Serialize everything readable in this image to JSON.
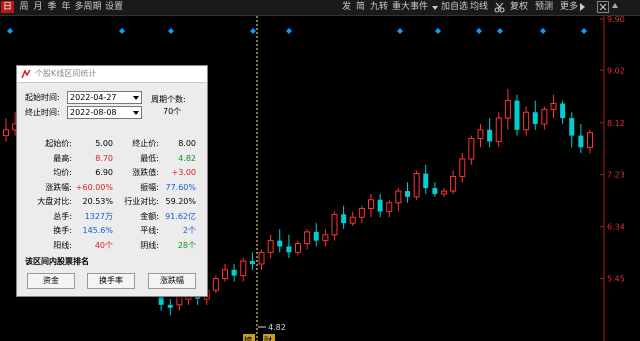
{
  "period_tabs": [
    {
      "label": "日",
      "active": true
    },
    {
      "label": "周",
      "active": false
    },
    {
      "label": "月",
      "active": false
    },
    {
      "label": "季",
      "active": false
    },
    {
      "label": "年",
      "active": false
    },
    {
      "label": "多周期",
      "active": false
    },
    {
      "label": "设置",
      "active": false
    }
  ],
  "toolbar_right": [
    "发",
    "简",
    "九转",
    "重大事件",
    "加自选",
    "均线",
    "复权",
    "预测",
    "更多"
  ],
  "colors": {
    "up": "#ff3333",
    "down": "#00d0d0",
    "axis_label": "#e03030",
    "diamond": "#00a0ff",
    "selection": "#ffff80"
  },
  "axis": {
    "price_labels": [
      "9.90",
      "9.02",
      "8.12",
      "7.23",
      "6.34",
      "5.45"
    ]
  },
  "low_marker": "4.82",
  "bottom_marks": [
    "榜",
    "财"
  ],
  "chart_data": {
    "type": "candlestick",
    "ylim": [
      4.5,
      9.95
    ],
    "y_ticks": [
      9.9,
      9.02,
      8.12,
      7.23,
      6.34,
      5.45
    ],
    "candles": [
      [
        7.9,
        8.2,
        8.0,
        7.8
      ],
      [
        8.0,
        8.3,
        8.1,
        7.9
      ],
      [
        7.9,
        8.0,
        7.5,
        7.4
      ],
      [
        7.5,
        7.7,
        7.6,
        7.3
      ],
      [
        7.6,
        7.9,
        7.7,
        7.5
      ],
      [
        6.8,
        7.0,
        6.9,
        6.6
      ],
      [
        6.9,
        7.0,
        6.8,
        6.7
      ],
      [
        6.9,
        7.1,
        7.0,
        6.8
      ],
      [
        6.9,
        7.0,
        6.85,
        6.7
      ],
      [
        6.8,
        6.9,
        6.7,
        6.6
      ],
      [
        6.7,
        6.8,
        6.5,
        6.4
      ],
      [
        6.5,
        6.6,
        6.2,
        6.1
      ],
      [
        6.2,
        6.3,
        6.0,
        5.9
      ],
      [
        6.0,
        6.1,
        5.7,
        5.6
      ],
      [
        5.7,
        5.9,
        5.8,
        5.6
      ],
      [
        5.8,
        5.9,
        5.6,
        5.5
      ],
      [
        5.6,
        5.7,
        5.3,
        5.2
      ],
      [
        5.3,
        5.4,
        5.0,
        4.9
      ],
      [
        5.0,
        5.1,
        4.95,
        4.82
      ],
      [
        5.0,
        5.2,
        5.15,
        4.9
      ],
      [
        5.1,
        5.3,
        5.25,
        5.0
      ],
      [
        5.2,
        5.4,
        5.1,
        5.0
      ],
      [
        5.1,
        5.3,
        5.25,
        5.0
      ],
      [
        5.25,
        5.5,
        5.45,
        5.2
      ],
      [
        5.45,
        5.7,
        5.6,
        5.4
      ],
      [
        5.6,
        5.7,
        5.5,
        5.4
      ],
      [
        5.5,
        5.8,
        5.75,
        5.4
      ],
      [
        5.75,
        5.9,
        5.7,
        5.6
      ],
      [
        5.7,
        5.95,
        5.9,
        5.6
      ],
      [
        5.9,
        6.2,
        6.1,
        5.8
      ],
      [
        6.1,
        6.3,
        6.0,
        5.9
      ],
      [
        6.0,
        6.2,
        5.9,
        5.8
      ],
      [
        5.9,
        6.1,
        6.05,
        5.85
      ],
      [
        6.05,
        6.3,
        6.25,
        5.95
      ],
      [
        6.25,
        6.4,
        6.1,
        6.0
      ],
      [
        6.1,
        6.3,
        6.2,
        6.0
      ],
      [
        6.2,
        6.6,
        6.55,
        6.1
      ],
      [
        6.55,
        6.7,
        6.4,
        6.3
      ],
      [
        6.4,
        6.6,
        6.5,
        6.35
      ],
      [
        6.5,
        6.7,
        6.65,
        6.4
      ],
      [
        6.65,
        6.9,
        6.8,
        6.5
      ],
      [
        6.8,
        6.9,
        6.6,
        6.5
      ],
      [
        6.6,
        6.8,
        6.75,
        6.5
      ],
      [
        6.75,
        7.0,
        6.95,
        6.6
      ],
      [
        6.95,
        7.1,
        6.85,
        6.75
      ],
      [
        6.85,
        7.3,
        7.25,
        6.8
      ],
      [
        7.25,
        7.4,
        7.0,
        6.9
      ],
      [
        7.0,
        7.1,
        6.9,
        6.85
      ],
      [
        6.9,
        7.0,
        6.95,
        6.85
      ],
      [
        6.95,
        7.3,
        7.2,
        6.9
      ],
      [
        7.2,
        7.6,
        7.5,
        7.1
      ],
      [
        7.5,
        7.9,
        7.85,
        7.4
      ],
      [
        7.85,
        8.1,
        8.0,
        7.7
      ],
      [
        8.0,
        8.2,
        7.8,
        7.7
      ],
      [
        7.8,
        8.3,
        8.2,
        7.7
      ],
      [
        8.2,
        8.7,
        8.5,
        8.0
      ],
      [
        8.5,
        8.6,
        8.0,
        7.9
      ],
      [
        8.0,
        8.4,
        8.3,
        7.9
      ],
      [
        8.3,
        8.5,
        8.1,
        8.0
      ],
      [
        8.1,
        8.4,
        8.35,
        8.0
      ],
      [
        8.35,
        8.6,
        8.45,
        8.2
      ],
      [
        8.45,
        8.5,
        8.2,
        8.1
      ],
      [
        8.2,
        8.3,
        7.9,
        7.7
      ],
      [
        7.9,
        8.1,
        7.7,
        7.6
      ],
      [
        7.7,
        8.0,
        7.95,
        7.6
      ]
    ]
  },
  "dialog": {
    "title": "个股K线区间统计",
    "start_label": "起始时间:",
    "start_value": "2022-04-27",
    "end_label": "终止时间:",
    "end_value": "2022-08-08",
    "period_label": "周期个数:",
    "period_value": "70个",
    "stats": [
      [
        {
          "t": "起始价:",
          "c": "blk"
        },
        {
          "t": "5.00",
          "c": "blk"
        },
        {
          "t": "终止价:",
          "c": "blk"
        },
        {
          "t": "8.00",
          "c": "blk"
        }
      ],
      [
        {
          "t": "最高:",
          "c": "blk"
        },
        {
          "t": "8.70",
          "c": "red"
        },
        {
          "t": "最低:",
          "c": "blk"
        },
        {
          "t": "4.82",
          "c": "green"
        }
      ],
      [
        {
          "t": "均价:",
          "c": "blk"
        },
        {
          "t": "6.90",
          "c": "blk"
        },
        {
          "t": "涨跌值:",
          "c": "blk"
        },
        {
          "t": "+3.00",
          "c": "red"
        }
      ],
      [
        {
          "t": "涨跌幅:",
          "c": "blk"
        },
        {
          "t": "+60.00%",
          "c": "red"
        },
        {
          "t": "振幅:",
          "c": "blk"
        },
        {
          "t": "77.60%",
          "c": "blue"
        }
      ],
      [
        {
          "t": "大盘对比:",
          "c": "blk"
        },
        {
          "t": "20.53%",
          "c": "blk"
        },
        {
          "t": "行业对比:",
          "c": "blk"
        },
        {
          "t": "59.20%",
          "c": "blk"
        }
      ],
      [
        {
          "t": "总手:",
          "c": "blk"
        },
        {
          "t": "1327万",
          "c": "blue"
        },
        {
          "t": "金额:",
          "c": "blk"
        },
        {
          "t": "91.62亿",
          "c": "blue"
        }
      ],
      [
        {
          "t": "换手:",
          "c": "blk"
        },
        {
          "t": "145.6%",
          "c": "blue"
        },
        {
          "t": "平线:",
          "c": "blk"
        },
        {
          "t": "2个",
          "c": "blue"
        }
      ],
      [
        {
          "t": "阳线:",
          "c": "blk"
        },
        {
          "t": "40个",
          "c": "red"
        },
        {
          "t": "阴线:",
          "c": "blk"
        },
        {
          "t": "28个",
          "c": "green"
        }
      ]
    ],
    "rank_title": "该区间内股票排名",
    "buttons": [
      "资金",
      "换手率",
      "涨跌幅"
    ]
  }
}
